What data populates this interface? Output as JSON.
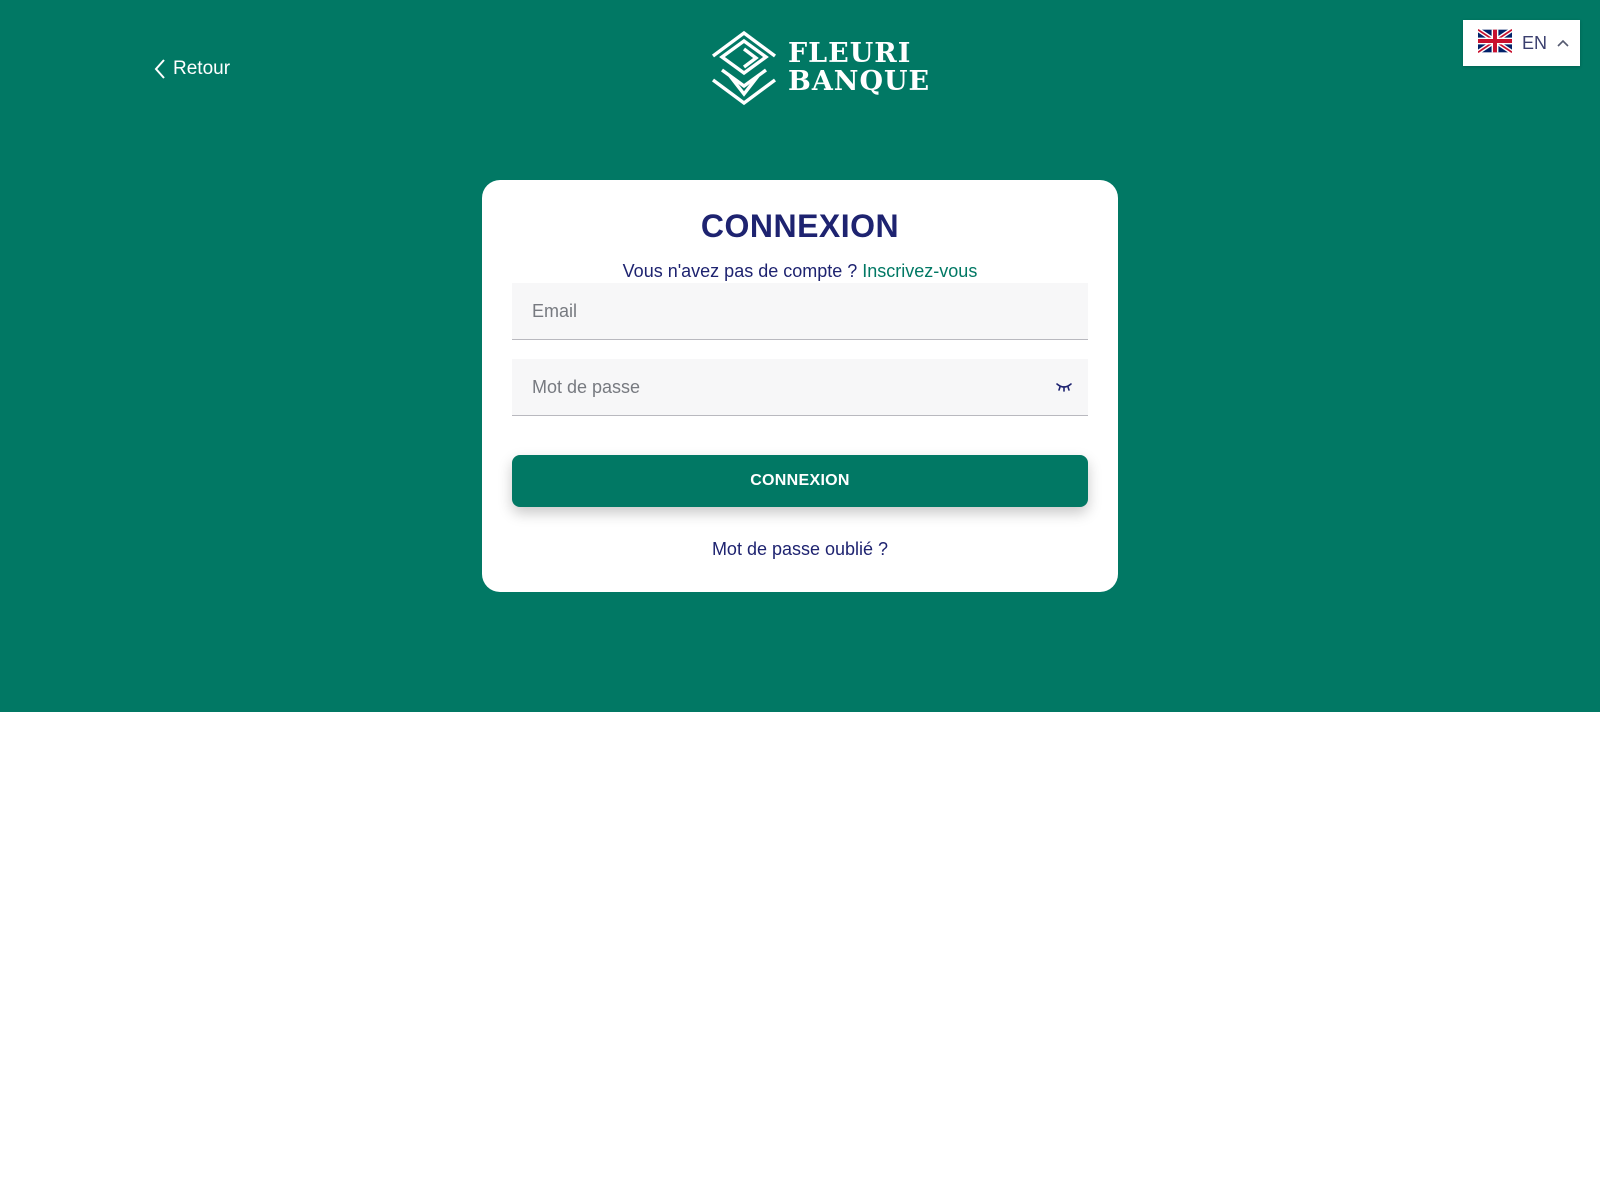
{
  "header": {
    "back_label": "Retour",
    "logo_line1": "FLEURI",
    "logo_line2": "BANQUE"
  },
  "language": {
    "code": "EN",
    "flag_icon": "uk-flag-icon",
    "chevron_icon": "chevron-up-icon"
  },
  "login": {
    "title": "CONNEXION",
    "no_account_text": "Vous n'avez pas de compte ?",
    "signup_link": "Inscrivez-vous",
    "email_placeholder": "Email",
    "password_placeholder": "Mot de passe",
    "password_toggle_icon": "eye-closed-icon",
    "submit_label": "CONNEXION",
    "forgot_password": "Mot de passe oublié ?"
  },
  "colors": {
    "brand_green": "#017864",
    "heading_navy": "#1e2370",
    "background": "#ffffff"
  }
}
